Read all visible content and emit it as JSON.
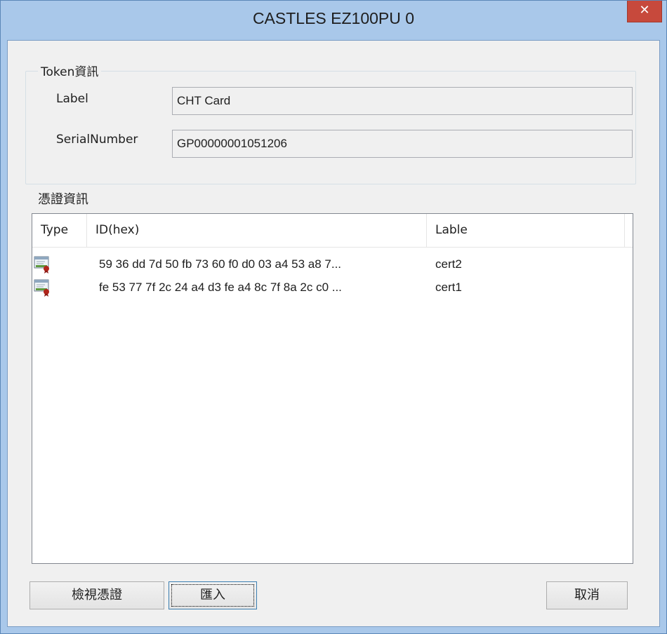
{
  "window": {
    "title": "CASTLES EZ100PU 0",
    "close_symbol": "✕"
  },
  "token_group": {
    "caption": "Token資訊",
    "label_caption": "Label",
    "label_value": "CHT Card",
    "serial_caption": "SerialNumber",
    "serial_value": "GP00000001051206"
  },
  "cert_section": {
    "title": "憑證資訊",
    "columns": [
      "Type",
      "ID(hex)",
      "Lable"
    ],
    "rows": [
      {
        "icon": "certificate-icon",
        "id_hex": "59 36 dd 7d 50 fb 73 60 f0 d0 03 a4 53 a8 7...",
        "label": "cert2"
      },
      {
        "icon": "certificate-icon",
        "id_hex": "fe 53 77 7f 2c 24 a4 d3 fe a4 8c 7f 8a 2c c0 ...",
        "label": "cert1"
      }
    ]
  },
  "buttons": {
    "view_cert": "檢視憑證",
    "import": "匯入",
    "cancel": "取消"
  },
  "colors": {
    "titlebar": "#a9c8ea",
    "close_button": "#c7493c",
    "client_bg": "#f0f0f0"
  }
}
